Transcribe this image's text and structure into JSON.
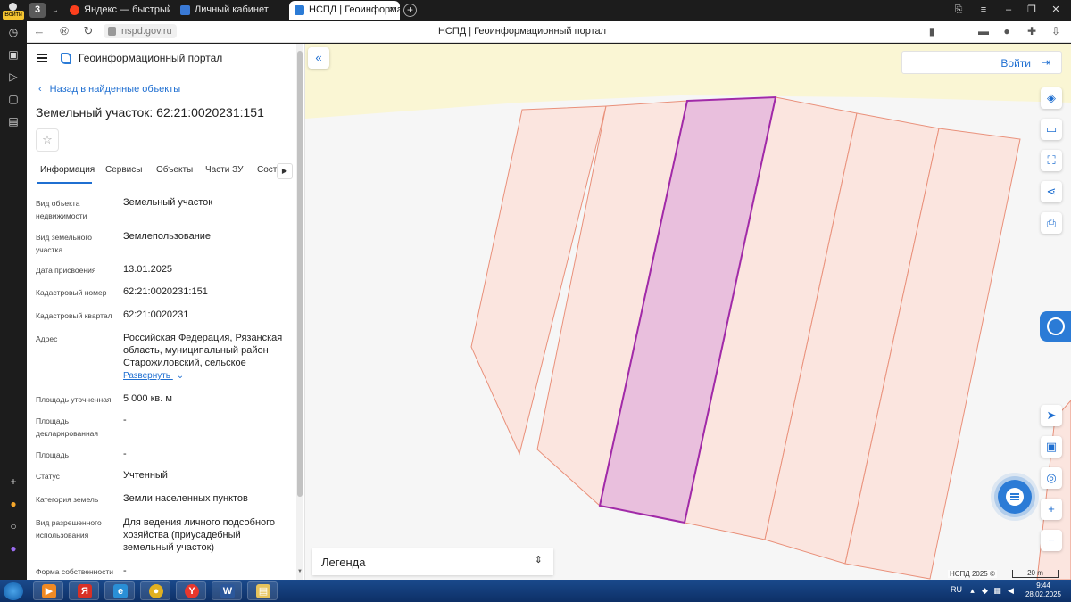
{
  "browser": {
    "login_badge": "Войти",
    "tab_count": "3",
    "tabs": [
      {
        "label": "Яндекс — быстрый поиск",
        "favicon_color": "#fc3f1d"
      },
      {
        "label": "Личный кабинет",
        "favicon_color": "#3a7ad6"
      },
      {
        "label": "НСПД | Геоинформацио",
        "favicon_color": "#2b7bd6"
      }
    ],
    "url": "nspd.gov.ru",
    "page_title": "НСПД | Геоинформационный портал"
  },
  "sidebar": {
    "portal_title": "Геоинформационный портал",
    "back_label": "Назад в найденные объекты",
    "object_title": "Земельный участок: 62:21:0020231:151",
    "tabs": [
      "Информация",
      "Сервисы",
      "Объекты",
      "Части ЗУ",
      "Соста"
    ],
    "properties": [
      {
        "label": "Вид объекта недвижимости",
        "value": "Земельный участок"
      },
      {
        "label": "Вид земельного участка",
        "value": "Землепользование"
      },
      {
        "label": "Дата присвоения",
        "value": "13.01.2025"
      },
      {
        "label": "Кадастровый номер",
        "value": "62:21:0020231:151"
      },
      {
        "label": "Кадастровый квартал",
        "value": "62:21:0020231"
      },
      {
        "label": "Адрес",
        "value": "Российская Федерация, Рязанская область, муниципальный район Старожиловский, сельское"
      },
      {
        "label": "Площадь уточненная",
        "value": "5 000 кв. м"
      },
      {
        "label": "Площадь декларированная",
        "value": "-"
      },
      {
        "label": "Площадь",
        "value": "-"
      },
      {
        "label": "Статус",
        "value": "Учтенный"
      },
      {
        "label": "Категория земель",
        "value": "Земли населенных пунктов"
      },
      {
        "label": "Вид разрешенного использования",
        "value": "Для ведения личного подсобного хозяйства (приусадебный земельный участок)"
      },
      {
        "label": "Форма собственности",
        "value": "-"
      }
    ],
    "expand_label": "Развернуть"
  },
  "map": {
    "login_label": "Войти",
    "legend_label": "Легенда",
    "attribution": "НСПД 2025 ©",
    "scale_label": "20 m",
    "colors": {
      "background": "#f6f6f6",
      "road": "#faf6d4",
      "parcel_fill": "#fbe5df",
      "parcel_stroke": "#e9907a",
      "selected_fill": "#e9bfdd",
      "selected_stroke": "#a12aa8",
      "accent": "#2b7bd6"
    }
  },
  "taskbar": {
    "language": "RU",
    "time": "9:44",
    "date": "28.02.2025"
  }
}
